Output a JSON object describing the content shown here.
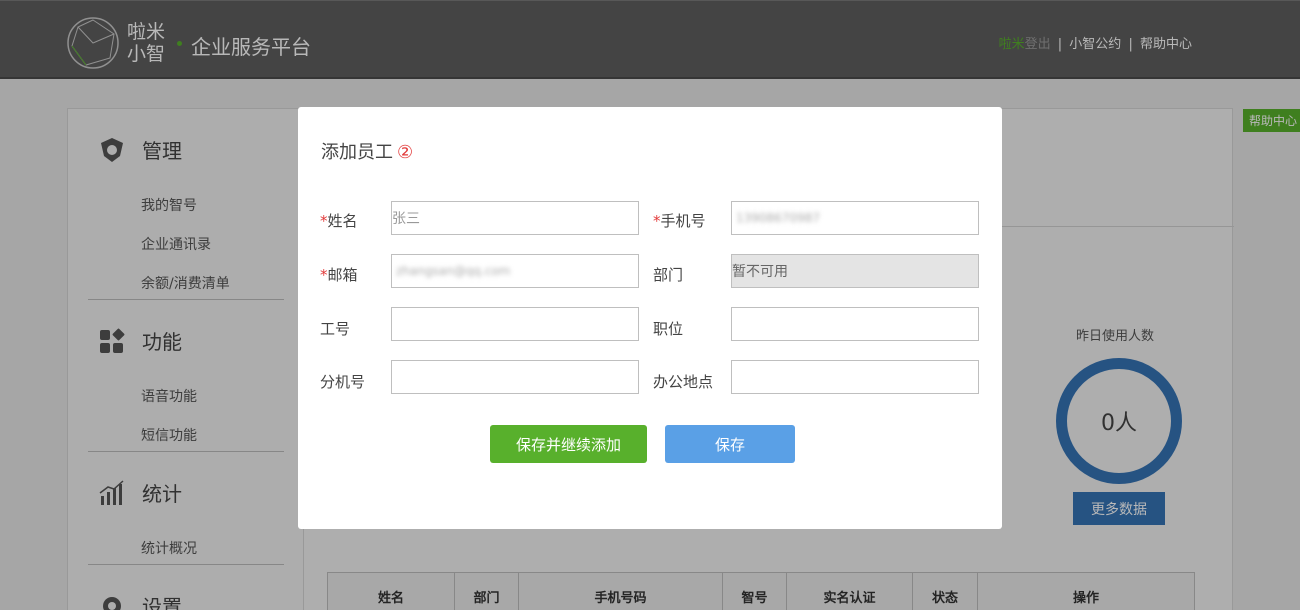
{
  "header": {
    "logo_line1": "啦米",
    "logo_line2": "小智",
    "platform": "企业服务平台",
    "nav_brand": "啦米",
    "nav_login": "登出",
    "nav_sep": "|",
    "nav_convention": "小智公约",
    "nav_help": "帮助中心"
  },
  "sidebar": {
    "sections": [
      {
        "title": "管理",
        "items": [
          "我的智号",
          "企业通讯录",
          "余额/消费清单"
        ]
      },
      {
        "title": "功能",
        "items": [
          "语音功能",
          "短信功能"
        ]
      },
      {
        "title": "统计",
        "items": [
          "统计概况"
        ]
      },
      {
        "title": "设置",
        "items": []
      }
    ]
  },
  "main": {
    "yesterday_label": "昨日使用人数",
    "yesterday_value": "0人",
    "more_data": "更多数据",
    "table_headers": [
      "姓名",
      "部门",
      "手机号码",
      "智号",
      "实名认证",
      "状态",
      "操作"
    ]
  },
  "help_tab": "帮助中心",
  "modal": {
    "title": "添加员工",
    "title_num": "②",
    "required_mark": "*",
    "name_label": "姓名",
    "name_value": "张三",
    "phone_label": "手机号",
    "phone_value": "13908670987",
    "email_label": "邮箱",
    "email_value": "zhangsan@qq.com",
    "dept_label": "部门",
    "dept_value": "暂不可用",
    "empno_label": "工号",
    "position_label": "职位",
    "ext_label": "分机号",
    "office_label": "办公地点",
    "save_continue": "保存并继续添加",
    "save": "保存"
  },
  "colors": {
    "green": "#58b02c",
    "blue": "#5aa0e6",
    "ring_blue": "#3573b5",
    "required_red": "#e23b3b",
    "header_bg": "#5f5f5f"
  }
}
